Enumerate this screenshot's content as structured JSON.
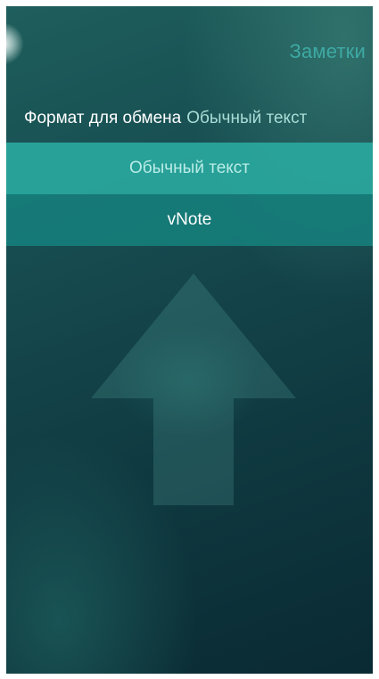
{
  "header": {
    "title": "Заметки"
  },
  "setting": {
    "label": "Формат для обмена",
    "value": "Обычный текст"
  },
  "menu": {
    "items": [
      {
        "label": "Обычный текст",
        "selected": true
      },
      {
        "label": "vNote",
        "selected": false
      }
    ]
  },
  "colors": {
    "accent": "#3ea9a4",
    "selected_item": "#2aaaa0",
    "item_background": "#16807c",
    "background": "#0f3940"
  }
}
